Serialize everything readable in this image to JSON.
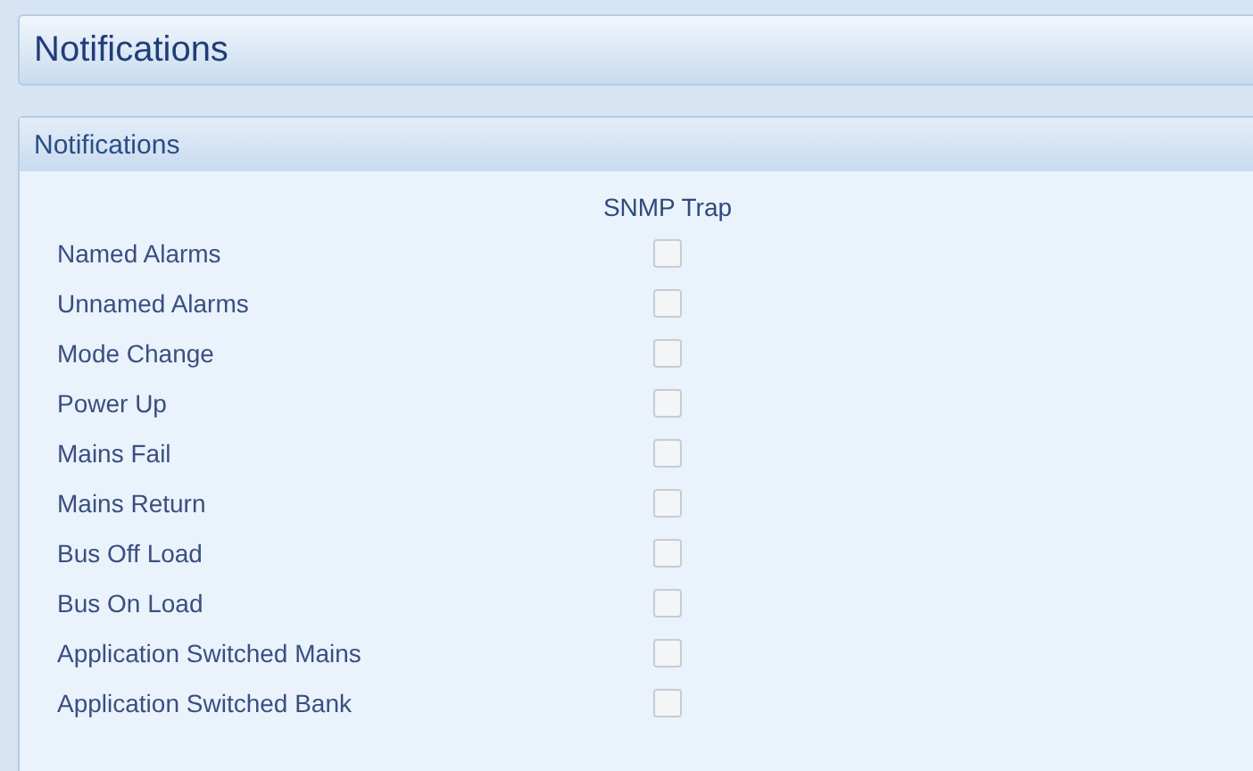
{
  "page_header": {
    "title": "Notifications"
  },
  "panel": {
    "title": "Notifications",
    "column_header": "SNMP Trap",
    "rows": [
      {
        "label": "Named Alarms",
        "checked": false
      },
      {
        "label": "Unnamed Alarms",
        "checked": false
      },
      {
        "label": "Mode Change",
        "checked": false
      },
      {
        "label": "Power Up",
        "checked": false
      },
      {
        "label": "Mains Fail",
        "checked": false
      },
      {
        "label": "Mains Return",
        "checked": false
      },
      {
        "label": "Bus Off Load",
        "checked": false
      },
      {
        "label": "Bus On Load",
        "checked": false
      },
      {
        "label": "Application Switched Mains",
        "checked": false
      },
      {
        "label": "Application Switched Bank",
        "checked": false
      }
    ]
  }
}
